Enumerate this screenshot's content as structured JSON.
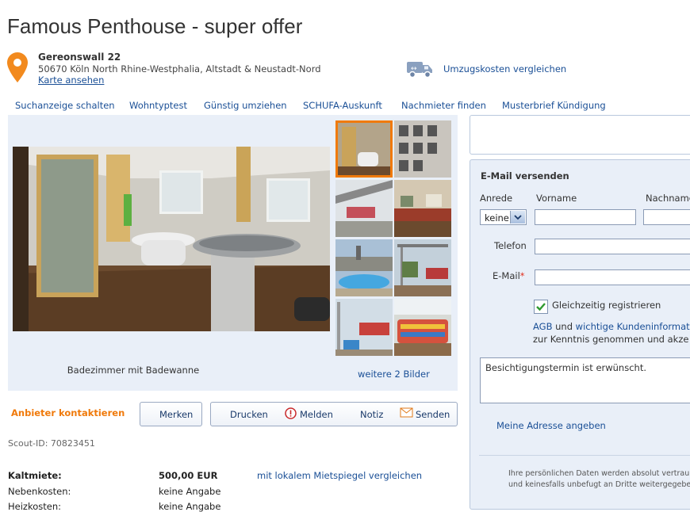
{
  "header": {
    "title": "Famous Penthouse - super offer",
    "street": "Gereonswall 22",
    "city_line": "50670 Köln North Rhine-Westphalia, Altstadt & Neustadt-Nord",
    "map_link": "Karte ansehen",
    "moving_link": "Umzugskosten vergleichen"
  },
  "nav": [
    "Suchanzeige schalten",
    "Wohntyptest",
    "Günstig umziehen",
    "SCHUFA-Auskunft",
    "Nachmieter finden",
    "Musterbrief Kündigung"
  ],
  "gallery": {
    "caption": "Badezimmer mit Badewanne",
    "more_link": "weitere 2 Bilder"
  },
  "actions": {
    "contact": "Anbieter kontaktieren",
    "bookmark": "Merken",
    "print": "Drucken",
    "report": "Melden",
    "note": "Notiz",
    "send": "Senden"
  },
  "scout_id": "Scout-ID: 70823451",
  "prices": [
    {
      "label": "Kaltmiete:",
      "value": "500,00 EUR",
      "bold": true
    },
    {
      "label": "Nebenkosten:",
      "value": "keine Angabe",
      "bold": false
    },
    {
      "label": "Heizkosten:",
      "value": "keine Angabe",
      "bold": false
    }
  ],
  "compare_link": "mit lokalem Mietspiegel vergleichen",
  "form": {
    "heading": "E-Mail versenden",
    "salutation_label": "Anrede",
    "salutation_value": "keine",
    "firstname_label": "Vorname",
    "lastname_label": "Nachname",
    "phone_label": "Telefon",
    "email_label": "E-Mail",
    "required_mark": "*",
    "register_label": "Gleichzeitig registrieren",
    "agb_link": "AGB",
    "and_text": "und",
    "privacy_link": "wichtige Kundeninformat",
    "consent_text": "zur Kenntnis genommen und akze",
    "message": "Besichtigungstermin ist erwünscht.",
    "address_link": "Meine Adresse angeben",
    "privacy_line1": "Ihre persönlichen Daten werden absolut vertrau",
    "privacy_line2": "und keinesfalls unbefugt an Dritte weitergegebe"
  },
  "colors": {
    "accent": "#f07a0b",
    "link": "#1a4f96",
    "panel": "#e9eff8"
  }
}
